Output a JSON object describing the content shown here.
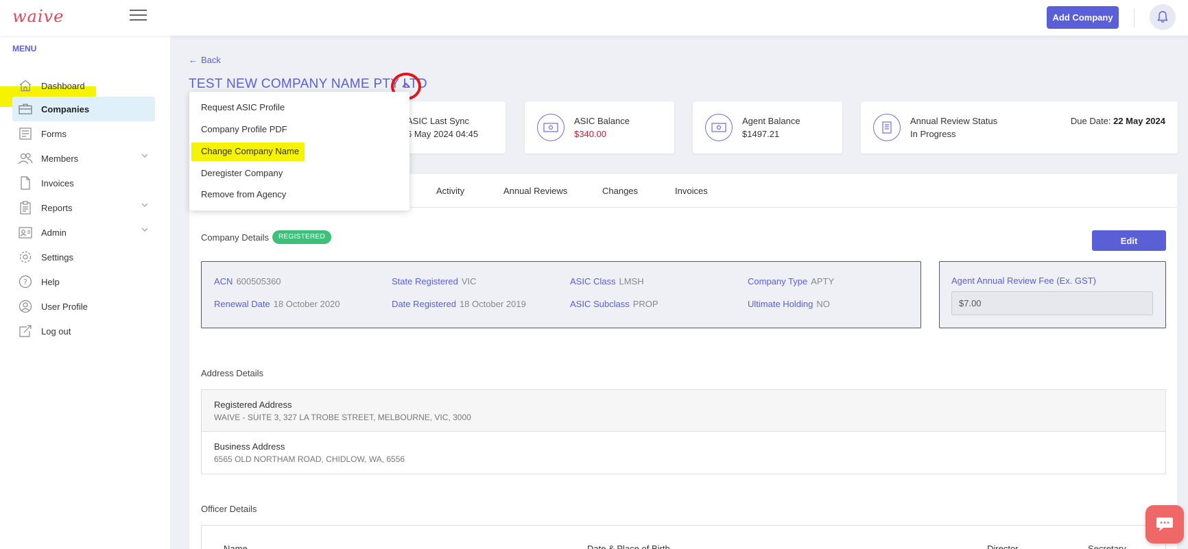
{
  "app": {
    "logo_text": "waive"
  },
  "topbar": {
    "add_company_label": "Add Company"
  },
  "sidebar": {
    "menu_label": "MENU",
    "items": [
      {
        "label": "Dashboard",
        "icon": "home-icon"
      },
      {
        "label": "Companies",
        "icon": "briefcase-icon",
        "active": true
      },
      {
        "label": "Forms",
        "icon": "forms-icon"
      },
      {
        "label": "Members",
        "icon": "users-icon",
        "expandable": true
      },
      {
        "label": "Invoices",
        "icon": "document-icon"
      },
      {
        "label": "Reports",
        "icon": "clipboard-icon",
        "expandable": true
      },
      {
        "label": "Admin",
        "icon": "admin-icon",
        "expandable": true
      },
      {
        "label": "Settings",
        "icon": "gear-icon"
      },
      {
        "label": "Help",
        "icon": "help-icon"
      },
      {
        "label": "User Profile",
        "icon": "user-icon"
      },
      {
        "label": "Log out",
        "icon": "logout-icon"
      }
    ]
  },
  "page": {
    "back_label": "Back",
    "company_title": "TEST NEW COMPANY NAME PTY LTD"
  },
  "dropdown": {
    "items": [
      "Request ASIC Profile",
      "Company Profile PDF",
      "Change Company Name",
      "Deregister Company",
      "Remove from Agency"
    ]
  },
  "stats": {
    "asic_sync": {
      "label": "ASIC Last Sync",
      "value": "6 May 2024 04:45"
    },
    "asic_balance": {
      "label": "ASIC Balance",
      "value": "$340.00"
    },
    "agent_balance": {
      "label": "Agent Balance",
      "value": "$1497.21"
    },
    "annual_review": {
      "label": "Annual Review Status",
      "value": "In Progress",
      "due_label": "Due Date:",
      "due_value": "22 May 2024"
    }
  },
  "tabs": [
    "Activity",
    "Annual Reviews",
    "Changes",
    "Invoices"
  ],
  "company_details": {
    "title": "Company Details",
    "status_badge": "REGISTERED",
    "edit_label": "Edit",
    "fields": {
      "acn": {
        "k": "ACN",
        "v": "600505360"
      },
      "state_registered": {
        "k": "State Registered",
        "v": "VIC"
      },
      "asic_class": {
        "k": "ASIC Class",
        "v": "LMSH"
      },
      "company_type": {
        "k": "Company Type",
        "v": "APTY"
      },
      "renewal_date": {
        "k": "Renewal Date",
        "v": "18 October 2020"
      },
      "date_registered": {
        "k": "Date Registered",
        "v": "18 October 2019"
      },
      "asic_subclass": {
        "k": "ASIC Subclass",
        "v": "PROP"
      },
      "ultimate_holding": {
        "k": "Ultimate Holding",
        "v": "NO"
      }
    },
    "fee_label": "Agent Annual Review Fee (Ex. GST)",
    "fee_value": "$7.00"
  },
  "address_details": {
    "title": "Address Details",
    "registered": {
      "label": "Registered Address",
      "value": "WAIVE - SUITE 3, 327 LA TROBE STREET, MELBOURNE, VIC, 3000"
    },
    "business": {
      "label": "Business Address",
      "value": "6565 OLD NORTHAM ROAD, CHIDLOW, WA, 6556"
    }
  },
  "officer_details": {
    "title": "Officer Details",
    "columns": [
      "Name",
      "Date & Place of Birth",
      "Director",
      "Secretary"
    ]
  },
  "colors": {
    "accent": "#5a5fd6",
    "success": "#3fc07a",
    "danger": "#c41e3a",
    "highlight": "#f5f300",
    "annotation_red": "#e3141b"
  }
}
